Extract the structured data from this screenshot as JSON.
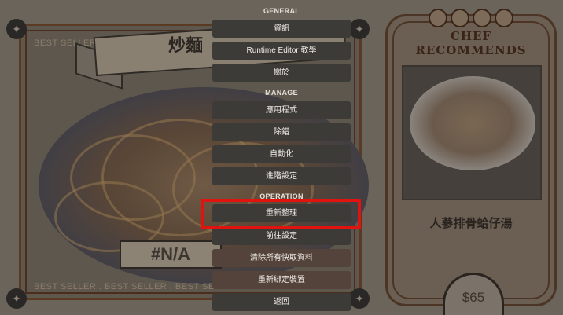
{
  "background": {
    "ticker_top": "BEST SELLER . BEST SELLER",
    "ticker_bottom": "BEST SELLER . BEST SELLER . BEST SELLER",
    "dish_title": "炒麵",
    "dish_price": "#N/A",
    "chef_title": "CHEF RECOMMENDS",
    "chef_dish": "人蔘排骨蛤仔湯",
    "chef_price": "$65",
    "corner_icon": "✦"
  },
  "menu": {
    "general": {
      "header": "GENERAL",
      "items": [
        "資訊",
        "Runtime Editor 教學",
        "關於"
      ]
    },
    "manage": {
      "header": "MANAGE",
      "items": [
        "應用程式",
        "除錯",
        "自動化",
        "進階設定"
      ]
    },
    "operation": {
      "header": "OPERATION",
      "items": [
        "重新整理",
        "前往設定",
        "清除所有快取資料",
        "重新綁定裝置",
        "返回"
      ]
    }
  },
  "highlight_color": "#e0130f"
}
